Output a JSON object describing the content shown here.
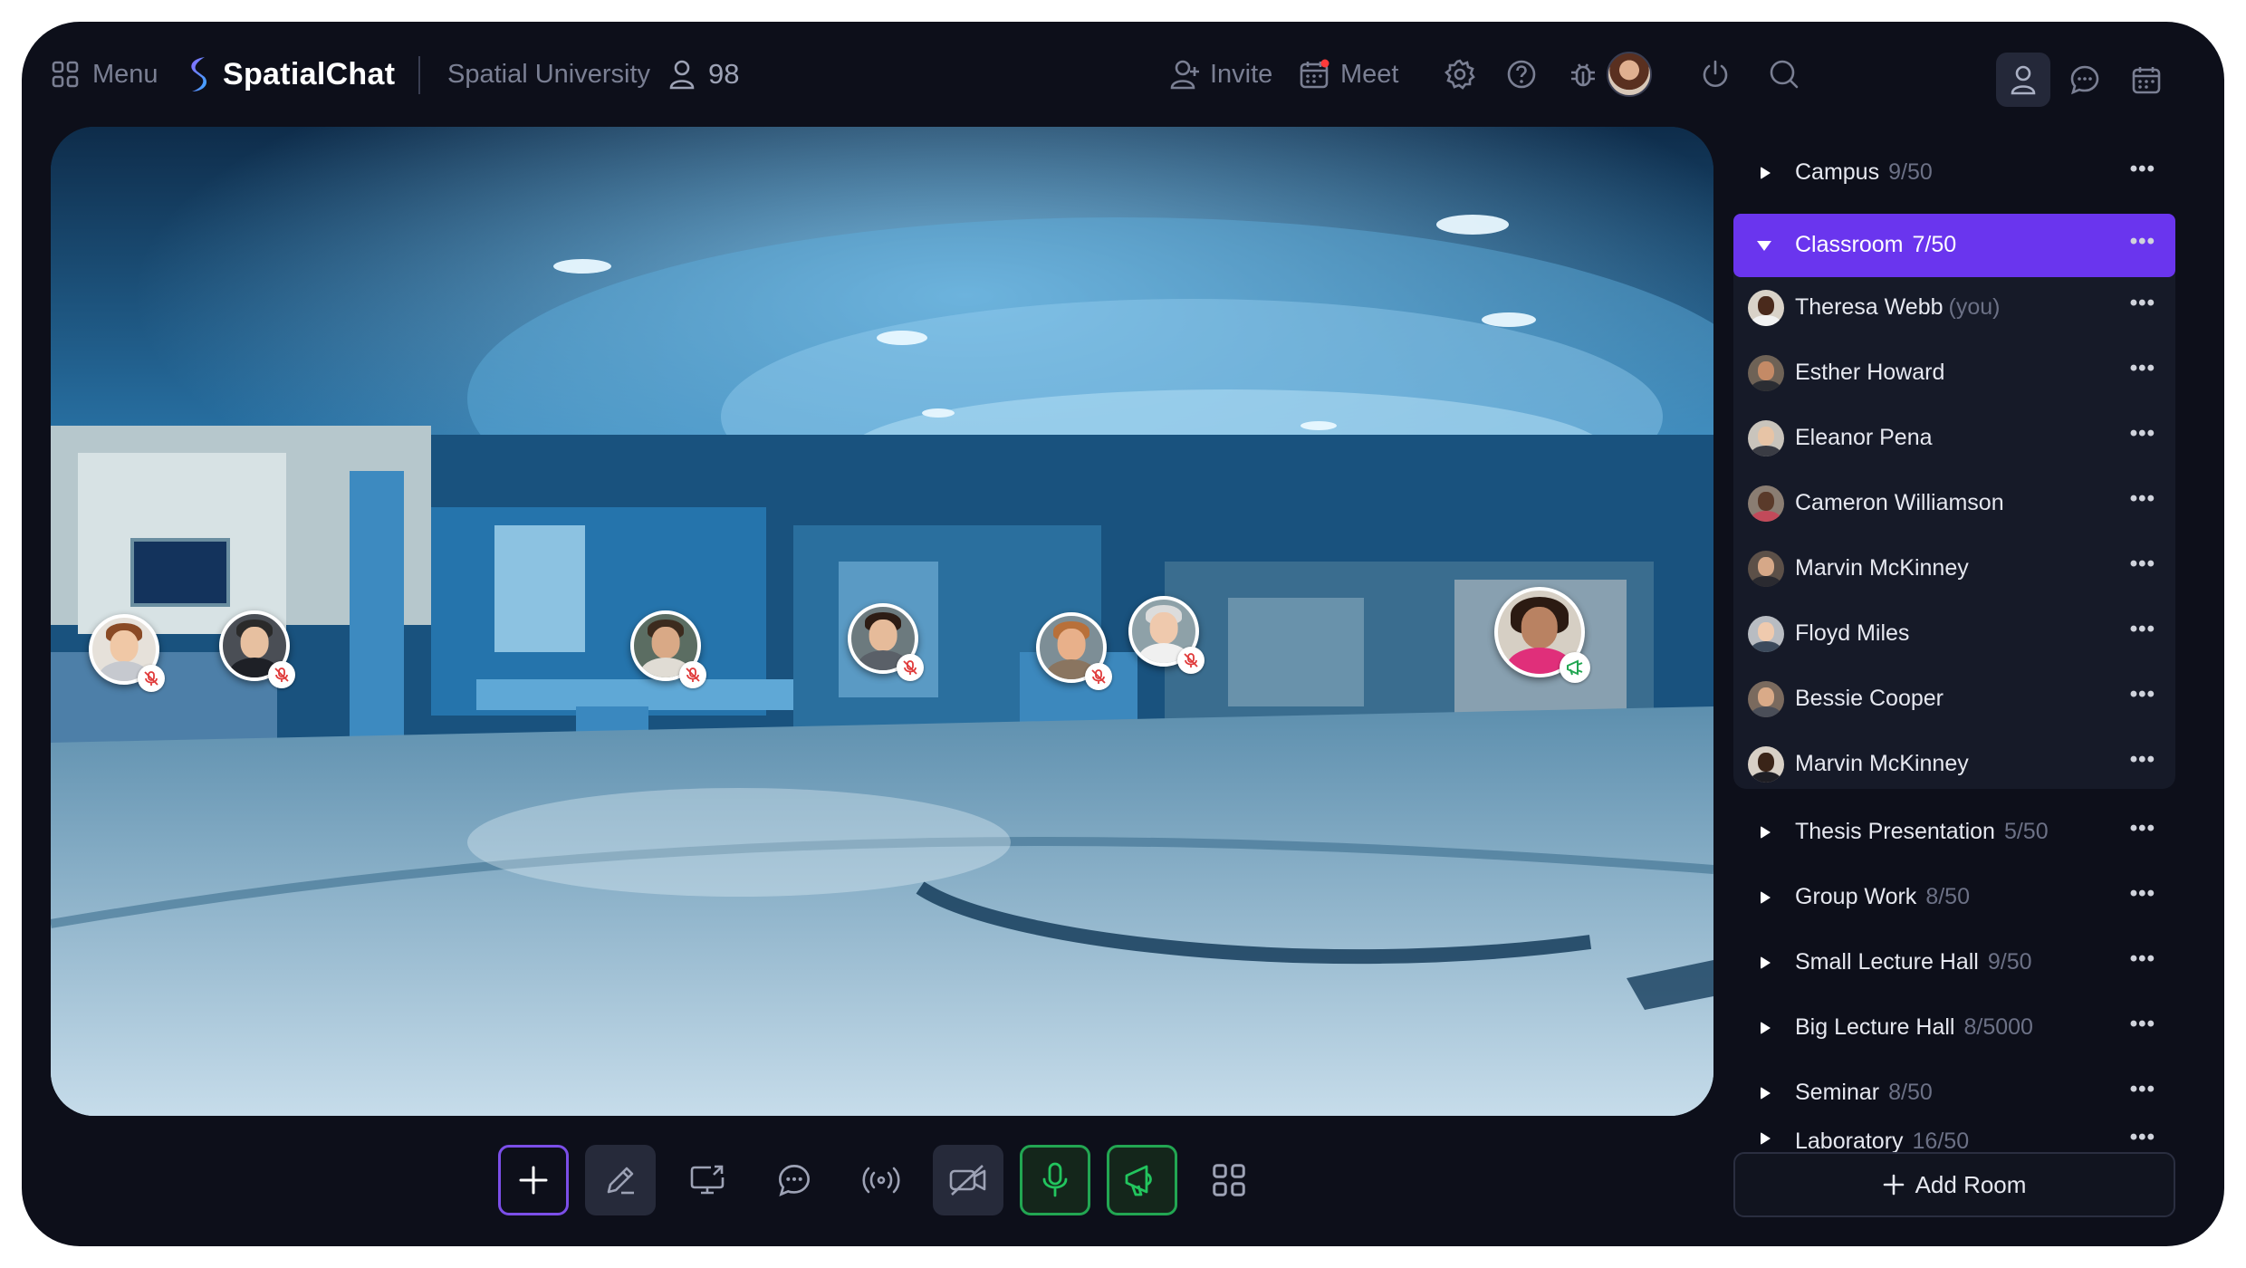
{
  "topbar": {
    "menu_label": "Menu",
    "brand_name": "SpatialChat",
    "space_name": "Spatial University",
    "member_count": "98",
    "invite_label": "Invite",
    "meet_label": "Meet"
  },
  "colors": {
    "background": "#0d0f1a",
    "accent": "#6a35ee",
    "active_green": "#22a652",
    "muted_text": "#6c7186"
  },
  "rooms": {
    "before": [
      {
        "name": "Campus",
        "count": "9/50"
      }
    ],
    "active": {
      "name": "Classroom",
      "count": "7/50"
    },
    "occupants": [
      {
        "name": "Theresa Webb",
        "suffix": "(you)"
      },
      {
        "name": "Esther Howard",
        "suffix": ""
      },
      {
        "name": "Eleanor Pena",
        "suffix": ""
      },
      {
        "name": "Cameron Williamson",
        "suffix": ""
      },
      {
        "name": "Marvin McKinney",
        "suffix": ""
      },
      {
        "name": "Floyd Miles",
        "suffix": ""
      },
      {
        "name": "Bessie Cooper",
        "suffix": ""
      },
      {
        "name": "Marvin McKinney",
        "suffix": ""
      }
    ],
    "after": [
      {
        "name": "Thesis Presentation",
        "count": "5/50"
      },
      {
        "name": "Group Work",
        "count": "8/50"
      },
      {
        "name": "Small Lecture Hall",
        "count": "9/50"
      },
      {
        "name": "Big Lecture Hall",
        "count": "8/5000"
      },
      {
        "name": "Seminar",
        "count": "8/50"
      },
      {
        "name": "Laboratory",
        "count": "16/50"
      }
    ],
    "more_icon": "more-dots-icon",
    "add_room_label": "Add Room"
  },
  "stage": {
    "participants": [
      {
        "name": "participant-1",
        "mic": "muted"
      },
      {
        "name": "participant-2",
        "mic": "muted"
      },
      {
        "name": "participant-3",
        "mic": "muted"
      },
      {
        "name": "participant-4",
        "mic": "muted"
      },
      {
        "name": "participant-5",
        "mic": "muted"
      },
      {
        "name": "participant-6",
        "mic": "muted"
      },
      {
        "name": "participant-7",
        "mic": "broadcasting"
      }
    ]
  },
  "toolbar": {
    "buttons": [
      "plus-icon",
      "pencil-icon",
      "screen-share-icon",
      "chat-icon",
      "broadcast-icon",
      "camera-off-icon",
      "microphone-icon",
      "megaphone-icon",
      "grid-icon"
    ]
  }
}
